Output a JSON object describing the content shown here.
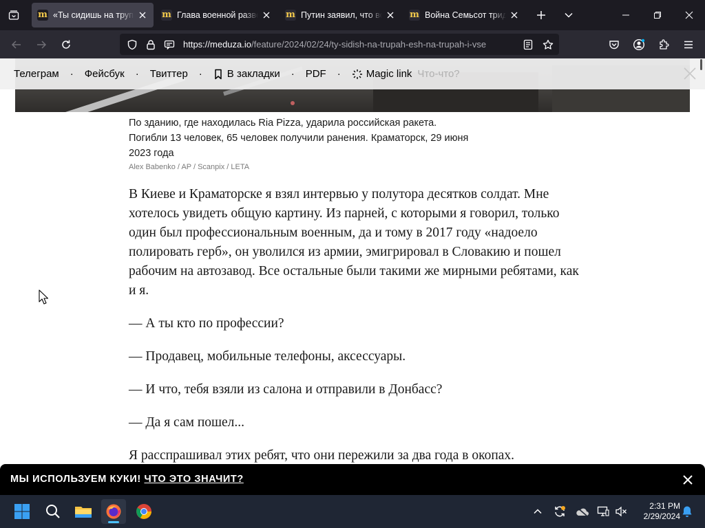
{
  "browser": {
    "tabs": [
      {
        "title": "«Ты сидишь на трупах, ешь на трупах",
        "active": true
      },
      {
        "title": "Глава военной разведки",
        "active": false
      },
      {
        "title": "Путин заявил, что война",
        "active": false
      },
      {
        "title": "Война Семьсот тридцать",
        "active": false
      }
    ],
    "url_host": "https://meduza.io",
    "url_path": "/feature/2024/02/24/ty-sidish-na-trupah-esh-na-trupah-i-vse"
  },
  "sharebar": {
    "items": [
      "Телеграм",
      "Фейсбук",
      "Твиттер",
      "В закладки",
      "PDF",
      "Magic link"
    ],
    "hint": "Что-что?"
  },
  "caption": {
    "text": "По зданию, где находилась Ria Pizza, ударила российская ракета. Погибли 13 человек, 65 человек получили ранения. Краматорск, 29 июня 2023 года",
    "credit": "Alex Babenko / AP / Scanpix / LETA"
  },
  "article": {
    "paragraphs": [
      "В Киеве и Краматорске я взял интервью у полутора десятков солдат. Мне хотелось увидеть общую картину. Из парней, с которыми я говорил, только один был профессиональным военным, да и тому в 2017 году «надоело полировать герб», он уволился из армии, эмигрировал в Словакию и пошел рабочим на автозавод. Все остальные были такими же мирными ребятами, как и я.",
      "— А ты кто по профессии?",
      "— Продавец, мобильные телефоны, аксессуары.",
      "— И что, тебя взяли из салона и отправили в Донбасс?",
      "— Да я сам пошел...",
      "Я расспрашивал этих ребят, что они пережили за два года в окопах."
    ]
  },
  "cookie_banner": {
    "text": "МЫ ИСПОЛЬЗУЕМ КУКИ!",
    "link": "ЧТО ЭТО ЗНАЧИТ?"
  },
  "taskbar": {
    "time": "2:31 PM",
    "date": "2/29/2024"
  },
  "icons": [
    "list-all-tabs-icon",
    "meduza-favicon",
    "close-icon",
    "new-tab-icon",
    "chevron-down-icon",
    "minimize-icon",
    "maximize-icon",
    "back-icon",
    "forward-icon",
    "reload-icon",
    "shield-icon",
    "lock-icon",
    "permissions-icon",
    "reader-view-icon",
    "star-icon",
    "pocket-icon",
    "account-icon",
    "extensions-icon",
    "menu-icon",
    "bookmark-icon",
    "magic-icon",
    "windows-start-icon",
    "search-icon",
    "file-explorer-icon",
    "firefox-icon",
    "chrome-icon",
    "chevron-up-icon",
    "sync-icon",
    "onedrive-icon",
    "network-icon",
    "volume-icon",
    "notification-icon",
    "mouse-cursor-icon"
  ],
  "colors": {
    "tabbar_bg": "#1c1b22",
    "navbar_bg": "#2b2a33",
    "active_tab": "#42414d",
    "taskbar_bg": "#1f2634",
    "meduza_gold": "#f2c94c"
  }
}
